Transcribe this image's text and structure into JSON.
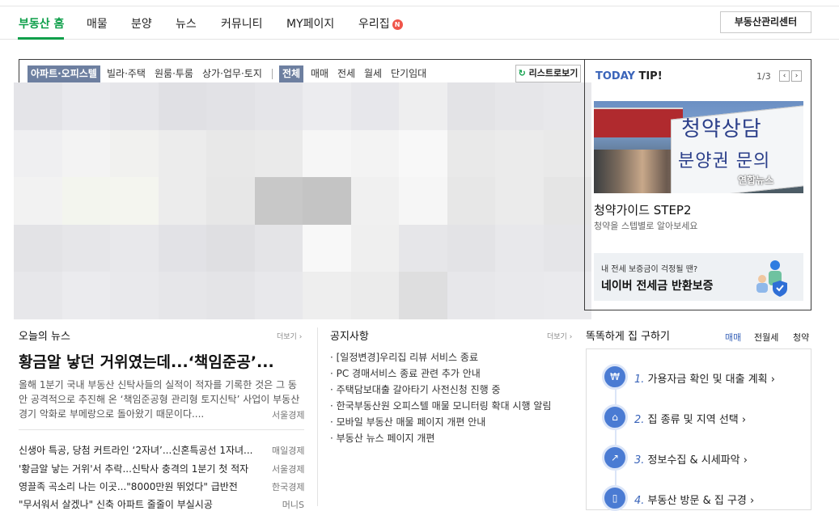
{
  "gnb": {
    "items": [
      "부동산 홈",
      "매물",
      "분양",
      "뉴스",
      "커뮤니티",
      "MY페이지",
      "우리집"
    ],
    "badge": "N",
    "mgmt_button": "부동산관리센터",
    "accent": "#0e9f4a"
  },
  "filters": {
    "types": [
      "아파트·오피스텔",
      "빌라·주택",
      "원룸·투룸",
      "상가·업무·토지"
    ],
    "trades": [
      "전체",
      "매매",
      "전세",
      "월세",
      "단기임대"
    ],
    "list_view": "리스트로보기"
  },
  "tip": {
    "title_a": "TODAY",
    "title_b": " TIP!",
    "page": "1/3",
    "image_text_1": "청약상담",
    "image_text_2": "분양권 문의",
    "image_watermark": "연합뉴스",
    "headline": "청약가이드 STEP2",
    "sub": "청약을 스텝별로 알아보세요",
    "banner_line1": "내 전세 보증금이 걱정될 땐?",
    "banner_line2": "네이버 전세금 반환보증"
  },
  "news": {
    "title": "오늘의 뉴스",
    "more": "더보기 ›",
    "headline": "황금알 낳던 거위였는데...‘책임준공’...",
    "body": "올해 1분기 국내 부동산 신탁사들의 실적이 적자를 기록한 것은 그 동안 공격적으로 추진해 온 ‘책임준공형 관리형 토지신탁’ 사업이 부동산 경기 악화로 부메랑으로 돌아왔기 때문이다....",
    "source": "서울경제",
    "items": [
      {
        "title": "신생아 특공, 당첨 커트라인 ‘2자녀’...신혼특공선 1자녀...",
        "source": "매일경제"
      },
      {
        "title": "'황금알 낳는 거위'서 추락...신탁사 충격의 1분기 첫 적자",
        "source": "서울경제"
      },
      {
        "title": "영끌족 곡소리 나는 이곳...\"8000만원 뛰었다\" 급반전",
        "source": "한국경제"
      },
      {
        "title": "\"무서워서 살겠나\" 신축 아파트 줄줄이 부실시공",
        "source": "머니S"
      }
    ]
  },
  "notice": {
    "title": "공지사항",
    "more": "더보기 ›",
    "items": [
      "· [일정변경]우리집 리뷰 서비스 종료",
      "· PC 경매서비스 종료 관련 추가 안내",
      "· 주택담보대출 갈아타기 사전신청 진행 중",
      "· 한국부동산원 오피스텔 매물 모니터링 확대 시행 알림",
      "· 모바일 부동산 매물 페이지 개편 안내",
      "· 부동산 뉴스 페이지 개편"
    ]
  },
  "house": {
    "title": "똑똑하게 집 구하기",
    "tabs": [
      "매매",
      "전월세",
      "청약"
    ],
    "steps": [
      {
        "num": "1.",
        "text": " 가용자금 확인 및 대출 계획 ›",
        "icon": "₩"
      },
      {
        "num": "2.",
        "text": " 집 종류 및 지역 선택 ›",
        "icon": "⌂"
      },
      {
        "num": "3.",
        "text": " 정보수집 & 시세파악 ›",
        "icon": "↗"
      },
      {
        "num": "4.",
        "text": " 부동산 방문 & 집 구경 ›",
        "icon": "▯"
      }
    ],
    "step_color": "#4a7bd3"
  }
}
